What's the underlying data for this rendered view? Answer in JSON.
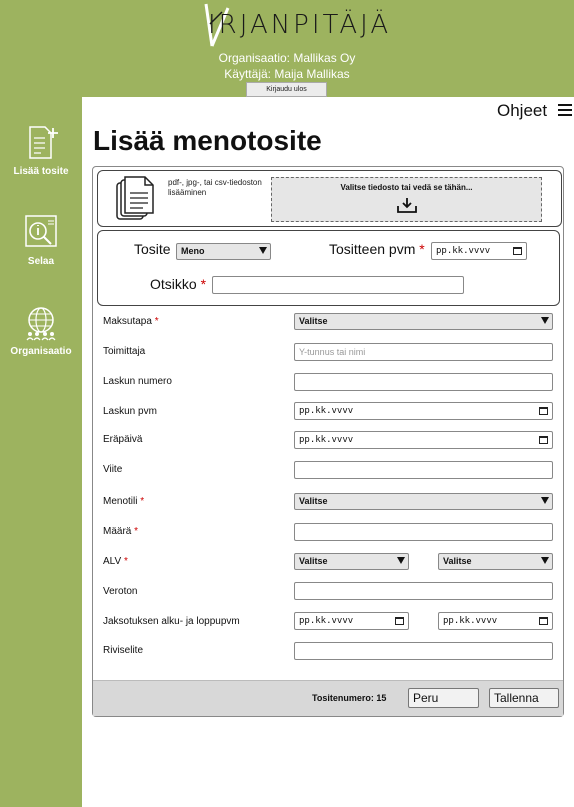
{
  "header": {
    "logo_text": "IRJANPITÄJÄ",
    "organization": "Organisaatio: Mallikas Oy",
    "user": "Käyttäjä: Maija Mallikas",
    "logout_label": "Kirjaudu ulos",
    "bg_color": "#9db35f"
  },
  "sidebar": {
    "items": [
      {
        "label": "Lisää tosite",
        "icon": "add-document-icon"
      },
      {
        "label": "Selaa",
        "icon": "browse-info-icon"
      },
      {
        "label": "Organisaatio",
        "icon": "organization-icon"
      }
    ]
  },
  "help": {
    "label": "Ohjeet",
    "icon": "menu-icon"
  },
  "page": {
    "title": "Lisää menotosite"
  },
  "upload": {
    "hint": "pdf-, jpg-, tai csv-tiedoston lisääminen",
    "dropzone_label": "Valitse tiedosto tai vedä se tähän..."
  },
  "meta": {
    "tosite_label": "Tosite",
    "tosite_value": "Meno",
    "date_label": "Tositteen pvm",
    "date_value": "pp.kk.vvvv",
    "title_label": "Otsikko",
    "title_value": ""
  },
  "form": {
    "maksutapa_label": "Maksutapa",
    "maksutapa_value": "Valitse",
    "toimittaja_label": "Toimittaja",
    "toimittaja_placeholder": "Y-tunnus tai nimi",
    "laskunumero_label": "Laskun numero",
    "laskupvm_label": "Laskun pvm",
    "laskupvm_value": "pp.kk.vvvv",
    "erapaiva_label": "Eräpäivä",
    "erapaiva_value": "pp.kk.vvvv",
    "viite_label": "Viite",
    "menotili_label": "Menotili",
    "menotili_value": "Valitse",
    "maara_label": "Määrä",
    "alv_label": "ALV",
    "alv_value_1": "Valitse",
    "alv_value_2": "Valitse",
    "veroton_label": "Veroton",
    "jaksotus_label": "Jaksotuksen alku- ja loppupvm",
    "jaksotus_start": "pp.kk.vvvv",
    "jaksotus_end": "pp.kk.vvvv",
    "riviselite_label": "Riviselite",
    "required_mark": "*"
  },
  "footer": {
    "number_text": "Tositenumero: 15",
    "cancel_label": "Peru",
    "save_label": "Tallenna"
  }
}
